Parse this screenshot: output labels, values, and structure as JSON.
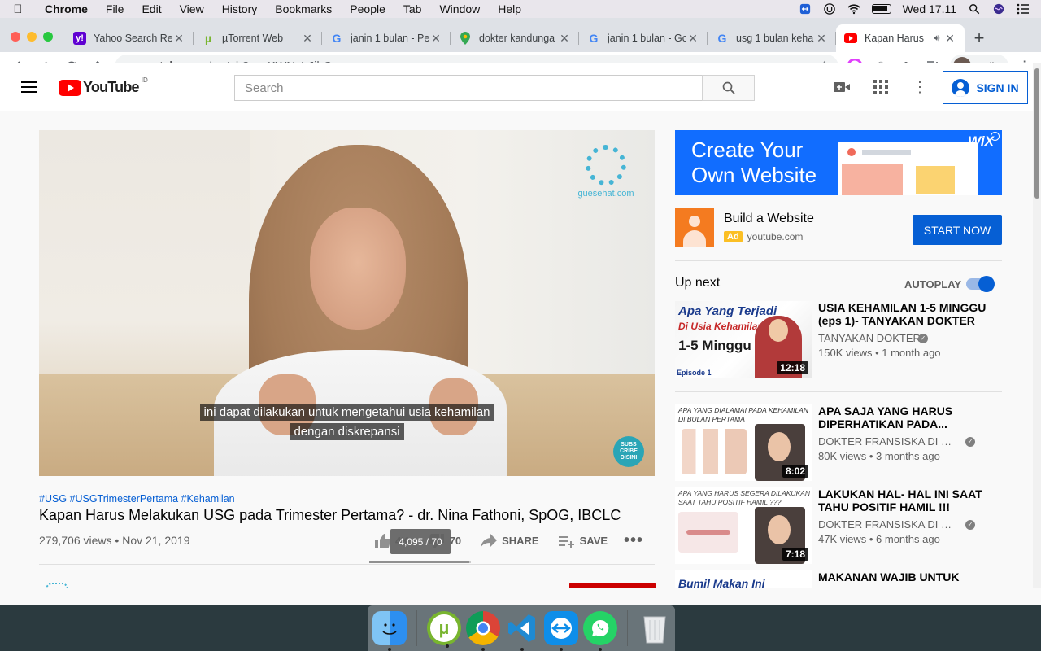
{
  "menubar": {
    "app_name": "Chrome",
    "items": [
      "File",
      "Edit",
      "View",
      "History",
      "Bookmarks",
      "People",
      "Tab",
      "Window",
      "Help"
    ],
    "clock": "Wed 17.11"
  },
  "browser": {
    "tabs": [
      {
        "title": "Yahoo Search Re",
        "favicon": "yahoo-icon",
        "color": "#6001d2"
      },
      {
        "title": "µTorrent Web",
        "favicon": "utorrent-icon",
        "color": "#78b52f"
      },
      {
        "title": "janin 1 bulan - Pe",
        "favicon": "google-icon",
        "color": "#4285f4"
      },
      {
        "title": "dokter kandunga",
        "favicon": "google-maps-icon",
        "color": "#34a853"
      },
      {
        "title": "janin 1 bulan - Go",
        "favicon": "google-icon",
        "color": "#4285f4"
      },
      {
        "title": "usg 1 bulan keha",
        "favicon": "google-icon",
        "color": "#4285f4"
      },
      {
        "title": "Kapan Harus",
        "favicon": "youtube-icon",
        "color": "#ff0000",
        "active": true
      }
    ],
    "url_host": "youtube.com",
    "url_path": "/watch?v=xKWNxIrJihQ",
    "profile_name": "Della"
  },
  "youtube": {
    "region": "ID",
    "search_placeholder": "Search",
    "signin_label": "SIGN IN",
    "video": {
      "caption_line1": "ini dapat dilakukan untuk mengetahui usia kehamilan",
      "caption_line2": "dengan diskrepansi",
      "watermark": "guesehat.com",
      "subscribe_badge": "SUBS CRIBE DISINI",
      "hashtags": "#USG #USGTrimesterPertama #Kehamilan",
      "title": "Kapan Harus Melakukan USG pada Trimester Pertama? - dr. Nina Fathoni, SpOG, IBCLC",
      "views": "279,706 views",
      "date": "Nov 21, 2019",
      "likes": "4K",
      "dislikes": "70",
      "share_label": "SHARE",
      "save_label": "SAVE",
      "like_tooltip": "4,095 / 70",
      "like_ratio": 0.983
    },
    "ad": {
      "banner_line1": "Create Your",
      "banner_line2": "Own Website",
      "banner_brand": "WiX",
      "title": "Build a Website",
      "badge": "Ad",
      "domain": "youtube.com",
      "cta": "START NOW"
    },
    "up_next_label": "Up next",
    "autoplay_label": "AUTOPLAY",
    "autoplay_on": true,
    "recommendations": [
      {
        "title": "USIA KEHAMILAN 1-5 MINGGU (eps 1)- TANYAKAN DOKTER",
        "channel": "TANYAKAN DOKTER",
        "meta": "150K views • 1 month ago",
        "duration": "12:18",
        "thumb_l1": "Apa Yang Terjadi",
        "thumb_l2": "Di Usia Kehamilan",
        "thumb_l3": "1-5 Minggu",
        "thumb_l4": "Episode 1"
      },
      {
        "title": "APA SAJA YANG HARUS DIPERHATIKAN PADA...",
        "channel": "DOKTER FRANSISKA DI PER...",
        "meta": "80K views • 3 months ago",
        "duration": "8:02",
        "thumb_text": "APA YANG DIALAMAI PADA KEHAMILAN DI BULAN PERTAMA"
      },
      {
        "title": "LAKUKAN HAL- HAL INI SAAT TAHU POSITIF HAMIL !!!",
        "channel": "DOKTER FRANSISKA DI PER...",
        "meta": "47K views • 6 months ago",
        "duration": "7:18",
        "thumb_text": "APA YANG HARUS SEGERA DILAKUKAN SAAT TAHU POSITIF HAMIL ???"
      },
      {
        "title": "MAKANAN WAJIB UNTUK",
        "thumb_text": "Bumil Makan Ini"
      }
    ]
  },
  "dock": [
    "Finder",
    "µTorrent",
    "Google Chrome",
    "Visual Studio Code",
    "TeamViewer",
    "WhatsApp",
    "Trash"
  ]
}
